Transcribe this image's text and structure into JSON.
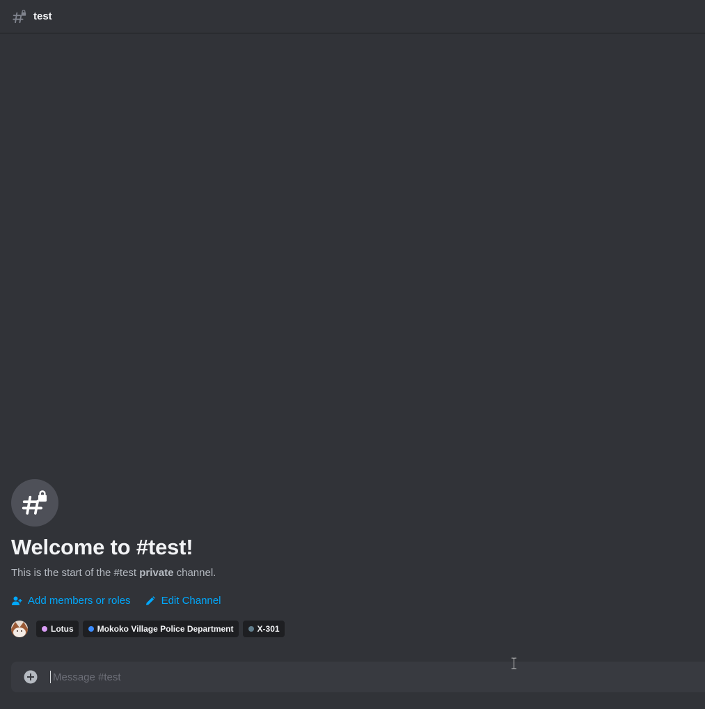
{
  "header": {
    "channel_icon": "hashtag-lock-icon",
    "channel_name": "test"
  },
  "welcome": {
    "icon": "hashtag-lock-icon",
    "title": "Welcome to #test!",
    "subtitle_prefix": "This is the start of the #test ",
    "subtitle_bold": "private",
    "subtitle_suffix": " channel."
  },
  "actions": {
    "add_members_label": "Add members or roles",
    "add_members_icon": "person-add-icon",
    "edit_channel_label": "Edit Channel",
    "edit_channel_icon": "pencil-icon"
  },
  "roles": [
    {
      "name": "Lotus",
      "color": "#d99df5"
    },
    {
      "name": "Mokoko Village Police Department",
      "color": "#3b8cff"
    },
    {
      "name": "X-301",
      "color": "#607d8b"
    }
  ],
  "composer": {
    "placeholder": "Message #test",
    "attach_icon": "plus-circle-icon"
  },
  "colors": {
    "background": "#313338",
    "accent_link": "#00a8fc"
  }
}
